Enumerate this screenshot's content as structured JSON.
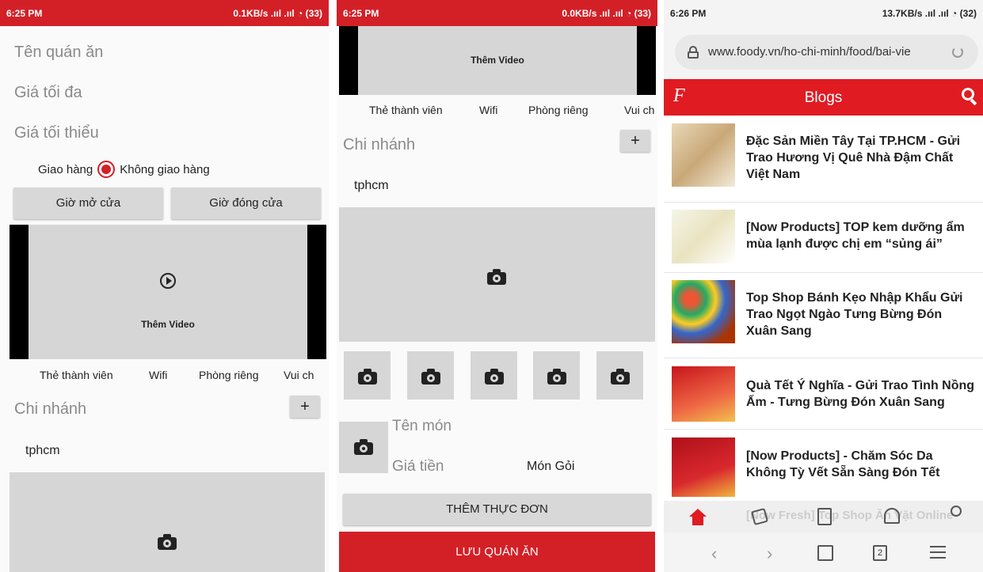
{
  "left": {
    "status": {
      "time": "6:25 PM",
      "net": "0.1KB/s .ııl .ııl ◔ (33)"
    },
    "fields": [
      "Tên quán ăn",
      "Giá tối đa",
      "Giá tối thiểu"
    ],
    "delivery": {
      "on": "Giao hàng",
      "off": "Không giao hàng"
    },
    "buttons": {
      "open": "Giờ mở cửa",
      "close": "Giờ đóng cửa"
    },
    "video_label": "Thêm Video",
    "tags": [
      "Thẻ thành viên",
      "Wifi",
      "Phòng riêng",
      "Vui ch"
    ],
    "branch_label": "Chi nhánh",
    "branch_value": "tphcm",
    "plus": "+"
  },
  "middle": {
    "status": {
      "time": "6:25 PM",
      "net": "0.0KB/s .ııl .ııl ◔ (33)"
    },
    "video_label": "Thêm Video",
    "tags": [
      "Thẻ thành viên",
      "Wifi",
      "Phòng riêng",
      "Vui ch"
    ],
    "branch_label": "Chi nhánh",
    "branch_value": "tphcm",
    "plus": "+",
    "dish_name": "Tên món",
    "dish_price": "Giá tiền",
    "dish_type": "Món Gỏi",
    "add_menu": "THÊM THỰC ĐƠN",
    "save": "LƯU QUÁN ĂN"
  },
  "right": {
    "status": {
      "time": "6:26 PM",
      "net": "13.7KB/s .ııl .ııl ◔ (32)"
    },
    "url": "www.foody.vn/ho-chi-minh/food/bai-vie",
    "logo": "F",
    "header": "Blogs",
    "blogs": [
      "Đặc Sản Miền Tây Tại TP.HCM - Gửi Trao Hương Vị Quê Nhà Đậm Chất Việt Nam",
      "[Now Products] TOP kem dưỡng ẩm mùa lạnh được chị em “sủng ái”",
      "Top Shop Bánh Kẹo Nhập Khẩu Gửi Trao Ngọt Ngào Tưng Bừng Đón Xuân Sang",
      "Quà Tết Ý Nghĩa - Gửi Trao Tình Nồng Ấm - Tưng Bừng Đón Xuân Sang",
      "[Now Products] - Chăm Sóc Da Không Tỳ Vết Sẵn Sàng Đón Tết"
    ],
    "peek": "[Now Fresh] Top Shop Ăn Vặt Online",
    "tab_count": "2"
  },
  "colors": {
    "brand": "#d32027",
    "gray": "#d6d6d6"
  }
}
